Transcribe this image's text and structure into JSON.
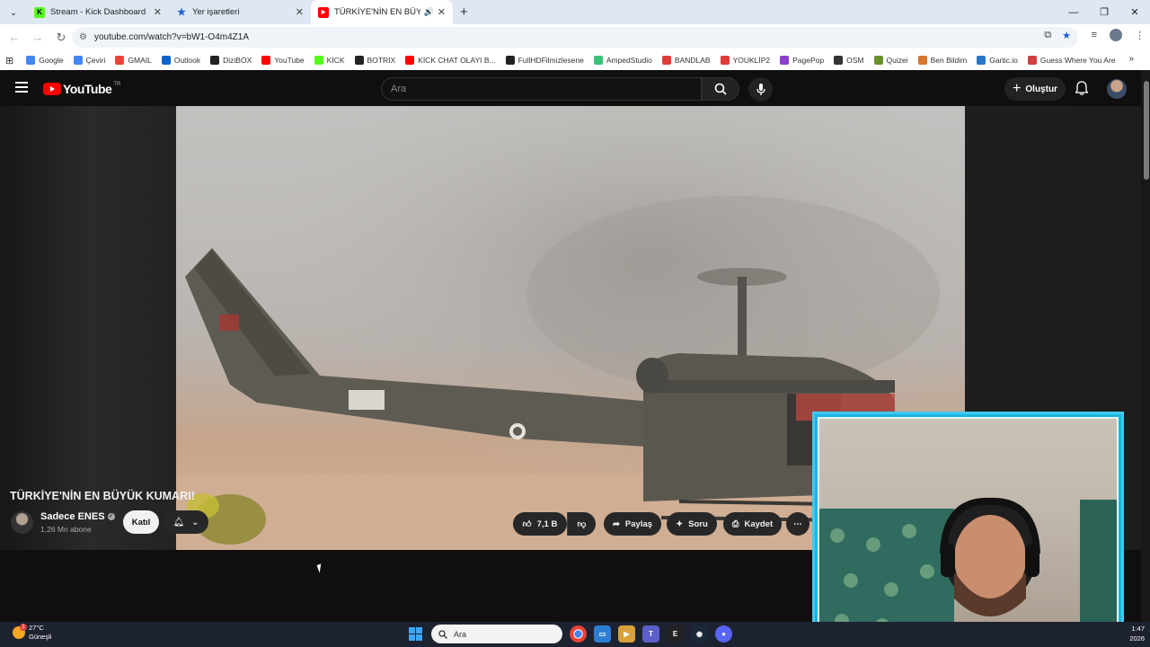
{
  "browser": {
    "tabs": [
      {
        "title": "Stream - Kick Dashboard",
        "favicon_color": "#53fc18",
        "favicon_letter": "K"
      },
      {
        "title": "Yer işaretleri",
        "favicon_color": "#1a5fd4",
        "favicon_letter": "★"
      },
      {
        "title": "TÜRKİYE'NİN EN BÜYÜK KU",
        "favicon_color": "#ff0000",
        "favicon_letter": "▶",
        "active": true
      }
    ],
    "url": "youtube.com/watch?v=bW1-O4m4Z1A",
    "bookmarks": [
      {
        "label": "Google",
        "color": "#4285f4"
      },
      {
        "label": "Çeviri",
        "color": "#4285f4"
      },
      {
        "label": "GMAIL",
        "color": "#ea4335"
      },
      {
        "label": "Outlook",
        "color": "#0a64c8"
      },
      {
        "label": "DiziBOX",
        "color": "#222222"
      },
      {
        "label": "YouTube",
        "color": "#ff0000"
      },
      {
        "label": "KİCK",
        "color": "#53fc18"
      },
      {
        "label": "BOTRİX",
        "color": "#222222"
      },
      {
        "label": "KİCK CHAT OLAYI B...",
        "color": "#ff0000"
      },
      {
        "label": "FullHDFilmizlesene",
        "color": "#222222"
      },
      {
        "label": "AmpedStudio",
        "color": "#39c27a"
      },
      {
        "label": "BANDLAB",
        "color": "#e23b3b"
      },
      {
        "label": "YOUKLİP2",
        "color": "#e23b3b"
      },
      {
        "label": "PagePop",
        "color": "#8a3fd1"
      },
      {
        "label": "OSM",
        "color": "#333333"
      },
      {
        "label": "Quizei",
        "color": "#6a8f2f"
      },
      {
        "label": "Ben Bildim",
        "color": "#d9742b"
      },
      {
        "label": "Gartic.io",
        "color": "#2a77c9"
      },
      {
        "label": "Guess Where You Are",
        "color": "#d04040"
      }
    ]
  },
  "youtube": {
    "logo": "YouTube",
    "region": "TR",
    "search_placeholder": "Ara",
    "create_label": "Oluştur",
    "video_title": "TÜRKİYE'NİN EN BÜYÜK KUMARI!",
    "channel": {
      "name": "Sadece ENES",
      "subscribers": "1,26 Mn abone",
      "join_label": "Katıl"
    },
    "actions": {
      "likes": "7,1 B",
      "share": "Paylaş",
      "ask": "Soru",
      "save": "Kaydet"
    }
  },
  "taskbar": {
    "weather_temp": "27°C",
    "weather_desc": "Güneşli",
    "weather_badge": "1",
    "search_placeholder": "Ara",
    "time": "1:47",
    "year": "2026"
  }
}
